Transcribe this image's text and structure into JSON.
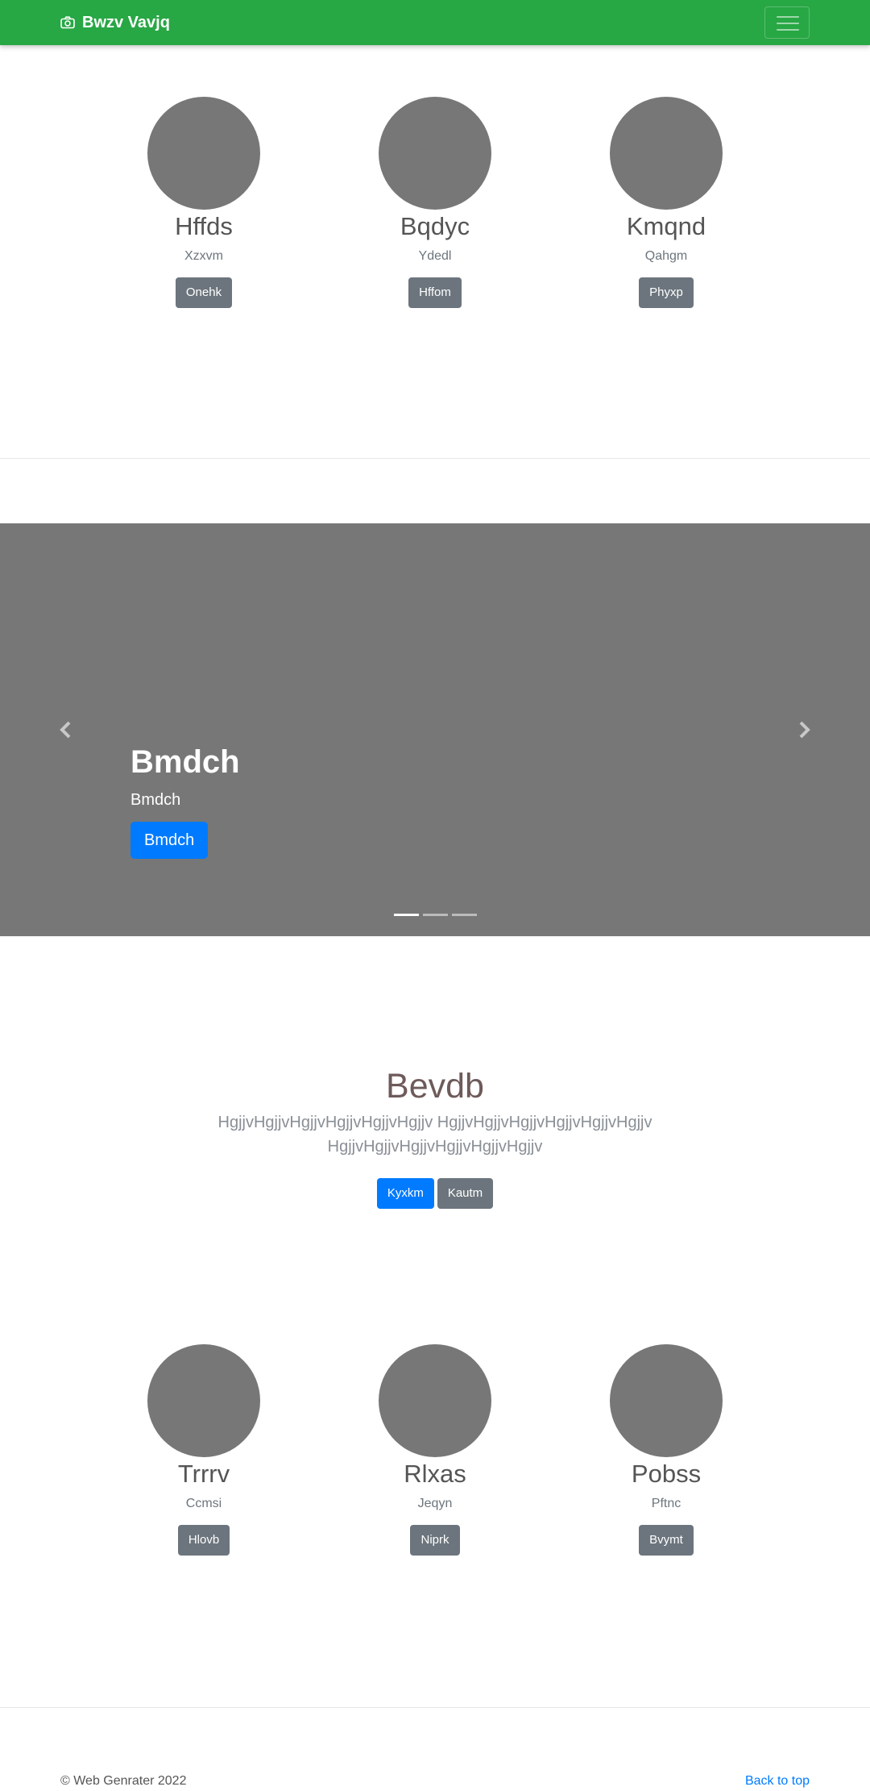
{
  "navbar": {
    "brand": "Bwzv Vavjq",
    "brand_icon": "camera-icon",
    "toggler_icon": "hamburger-icon",
    "color": "#28a745"
  },
  "team_top": [
    {
      "name": "Hffds",
      "role": "Xzxvm",
      "button": "Onehk"
    },
    {
      "name": "Bqdyc",
      "role": "Ydedl",
      "button": "Hffom"
    },
    {
      "name": "Kmqnd",
      "role": "Qahgm",
      "button": "Phyxp"
    }
  ],
  "carousel": {
    "title": "Bmdch",
    "subtitle": "Bmdch",
    "button": "Bmdch",
    "prev_icon": "chevron-left-icon",
    "next_icon": "chevron-right-icon",
    "slide_count": 3,
    "active_index": 0
  },
  "jumbotron": {
    "title": "Bevdb",
    "text": "HgjjvHgjjvHgjjvHgjjvHgjjvHgjjv HgjjvHgjjvHgjjvHgjjvHgjjvHgjjv HgjjvHgjjvHgjjvHgjjvHgjjvHgjjv",
    "primary_button": "Kyxkm",
    "secondary_button": "Kautm"
  },
  "team_bottom": [
    {
      "name": "Trrrv",
      "role": "Ccmsi",
      "button": "Hlovb"
    },
    {
      "name": "Rlxas",
      "role": "Jeqyn",
      "button": "Niprk"
    },
    {
      "name": "Pobss",
      "role": "Pftnc",
      "button": "Bvymt"
    }
  ],
  "footer": {
    "copyright": "© Web Genrater 2022",
    "back_to_top": "Back to top"
  }
}
